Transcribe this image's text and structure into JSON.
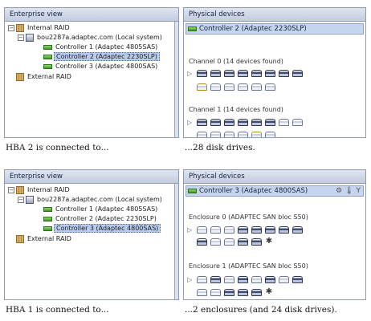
{
  "panel_titles": {
    "enterprise": "Enterprise view",
    "physical": "Physical devices"
  },
  "figure1": {
    "tree": {
      "internal": "Internal RAID",
      "system": "bou2287a.adaptec.com (Local system)",
      "controllers": [
        "Controller 1 (Adaptec 4805SAS)",
        "Controller 2 (Adaptec 2230SLP)",
        "Controller 3 (Adaptec 4800SAS)"
      ],
      "external": "External RAID"
    },
    "selected": "Controller 2 (Adaptec 2230SLP)",
    "groups": [
      {
        "label": "Channel 0   (14 devices found)"
      },
      {
        "label": "Channel 1   (14 devices found)"
      }
    ],
    "caption_left": "HBA 2 is connected to...",
    "caption_right": "...28 disk drives."
  },
  "figure2": {
    "tree": {
      "internal": "Internal RAID",
      "system": "bou2287a.adaptec.com (Local system)",
      "controllers": [
        "Controller 1 (Adaptec 4805SAS)",
        "Controller 2 (Adaptec 2230SLP)",
        "Controller 3 (Adaptec 4800SAS)"
      ],
      "external": "External RAID"
    },
    "selected": "Controller 3 (Adaptec 4800SAS)",
    "groups": [
      {
        "label": "Enclosure 0 (ADAPTEC SAN bloc S50)"
      },
      {
        "label": "Enclosure 1 (ADAPTEC SAN bloc S50)"
      }
    ],
    "caption_left": "HBA 1 is connected to...",
    "caption_right": "...2 enclosures (and 24 disk drives)."
  },
  "icons": [
    "building-icon",
    "server-icon",
    "controller-icon",
    "disk-icon",
    "fan-icon",
    "expand-arrow-icon"
  ]
}
